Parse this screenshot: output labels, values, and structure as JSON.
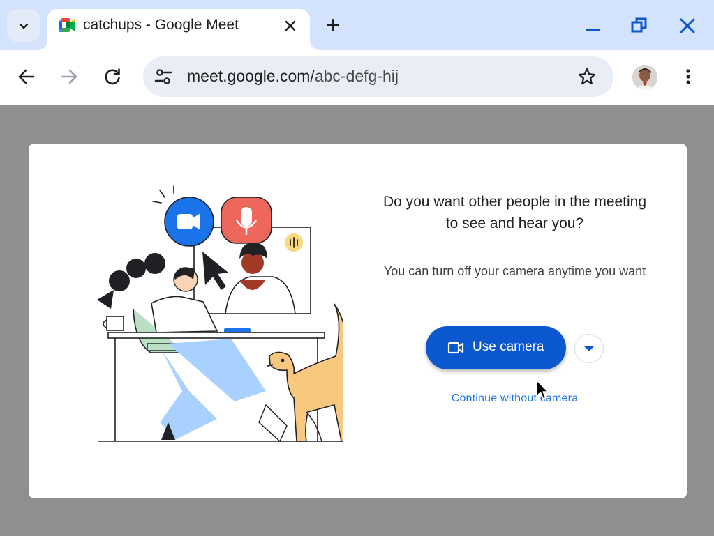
{
  "browser": {
    "tab": {
      "title": "catchups - Google Meet"
    },
    "url": {
      "domain": "meet.google.com/",
      "path": "abc-defg-hij"
    },
    "icons": {
      "tab_search": "chevron-down-icon",
      "favicon": "google-meet-icon",
      "tab_close": "close-icon",
      "new_tab": "plus-icon",
      "minimize": "minimize-icon",
      "restore": "restore-icon",
      "close_window": "close-icon",
      "back": "arrow-left-icon",
      "forward": "arrow-right-icon",
      "reload": "reload-icon",
      "site_info": "tune-icon",
      "bookmark": "star-icon",
      "menu": "more-vert-icon"
    }
  },
  "dialog": {
    "title": "Do you want other people in the meeting to see and hear you?",
    "subtitle": "You can turn off your camera anytime you want",
    "primary_button": "Use camera",
    "secondary_link": "Continue without camera"
  },
  "colors": {
    "tabstrip": "#d3e3fd",
    "omnibox": "#e9eef6",
    "primary": "#0b57d0",
    "link": "#1a73e8",
    "backdrop": "#8f8f8f"
  }
}
